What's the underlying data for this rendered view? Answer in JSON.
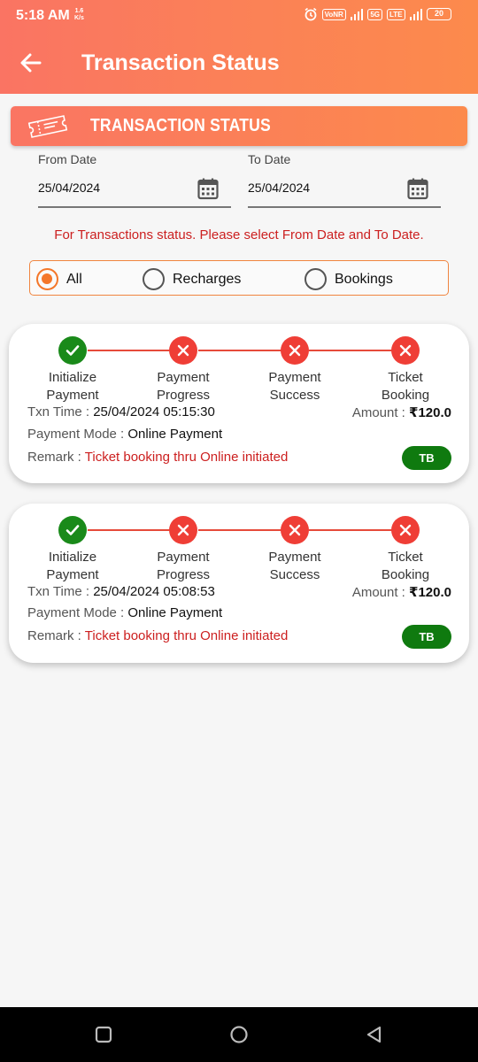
{
  "status_bar": {
    "time": "5:18 AM",
    "speed_value": "1.6",
    "speed_unit": "K/s",
    "network_1": "VoNR",
    "network_2": "5G",
    "network_3": "LTE",
    "battery": "20"
  },
  "header": {
    "title": "Transaction Status"
  },
  "banner": {
    "title": "TRANSACTION STATUS",
    "icon": "ticket-icon"
  },
  "filters": {
    "from_label": "From Date",
    "from_value": "25/04/2024",
    "to_label": "To Date",
    "to_value": "25/04/2024",
    "hint": "For Transactions status. Please select From Date and To Date.",
    "options": [
      "All",
      "Recharges",
      "Bookings"
    ],
    "selected": "All"
  },
  "steps": [
    {
      "line1": "Initialize",
      "line2": "Payment"
    },
    {
      "line1": "Payment",
      "line2": "Progress"
    },
    {
      "line1": "Payment",
      "line2": "Success"
    },
    {
      "line1": "Ticket",
      "line2": "Booking"
    }
  ],
  "labels": {
    "txn_time": "Txn Time : ",
    "amount": "Amount : ",
    "payment_mode": "Payment Mode : ",
    "remark": "Remark : "
  },
  "transactions": [
    {
      "step_status": [
        "success",
        "failed",
        "failed",
        "failed"
      ],
      "txn_time": "25/04/2024 05:15:30",
      "amount": "₹120.0",
      "payment_mode": "Online Payment",
      "remark": "Ticket booking thru Online initiated",
      "badge": "TB"
    },
    {
      "step_status": [
        "success",
        "failed",
        "failed",
        "failed"
      ],
      "txn_time": "25/04/2024 05:08:53",
      "amount": "₹120.0",
      "payment_mode": "Online Payment",
      "remark": "Ticket booking thru Online initiated",
      "badge": "TB"
    }
  ],
  "colors": {
    "header_start": "#fa7463",
    "header_end": "#fc8a4c",
    "accent": "#f4772a",
    "success": "#1a8a1a",
    "failed": "#ef3e36",
    "remark_text": "#cc1f1f",
    "badge": "#0f7a0f"
  }
}
